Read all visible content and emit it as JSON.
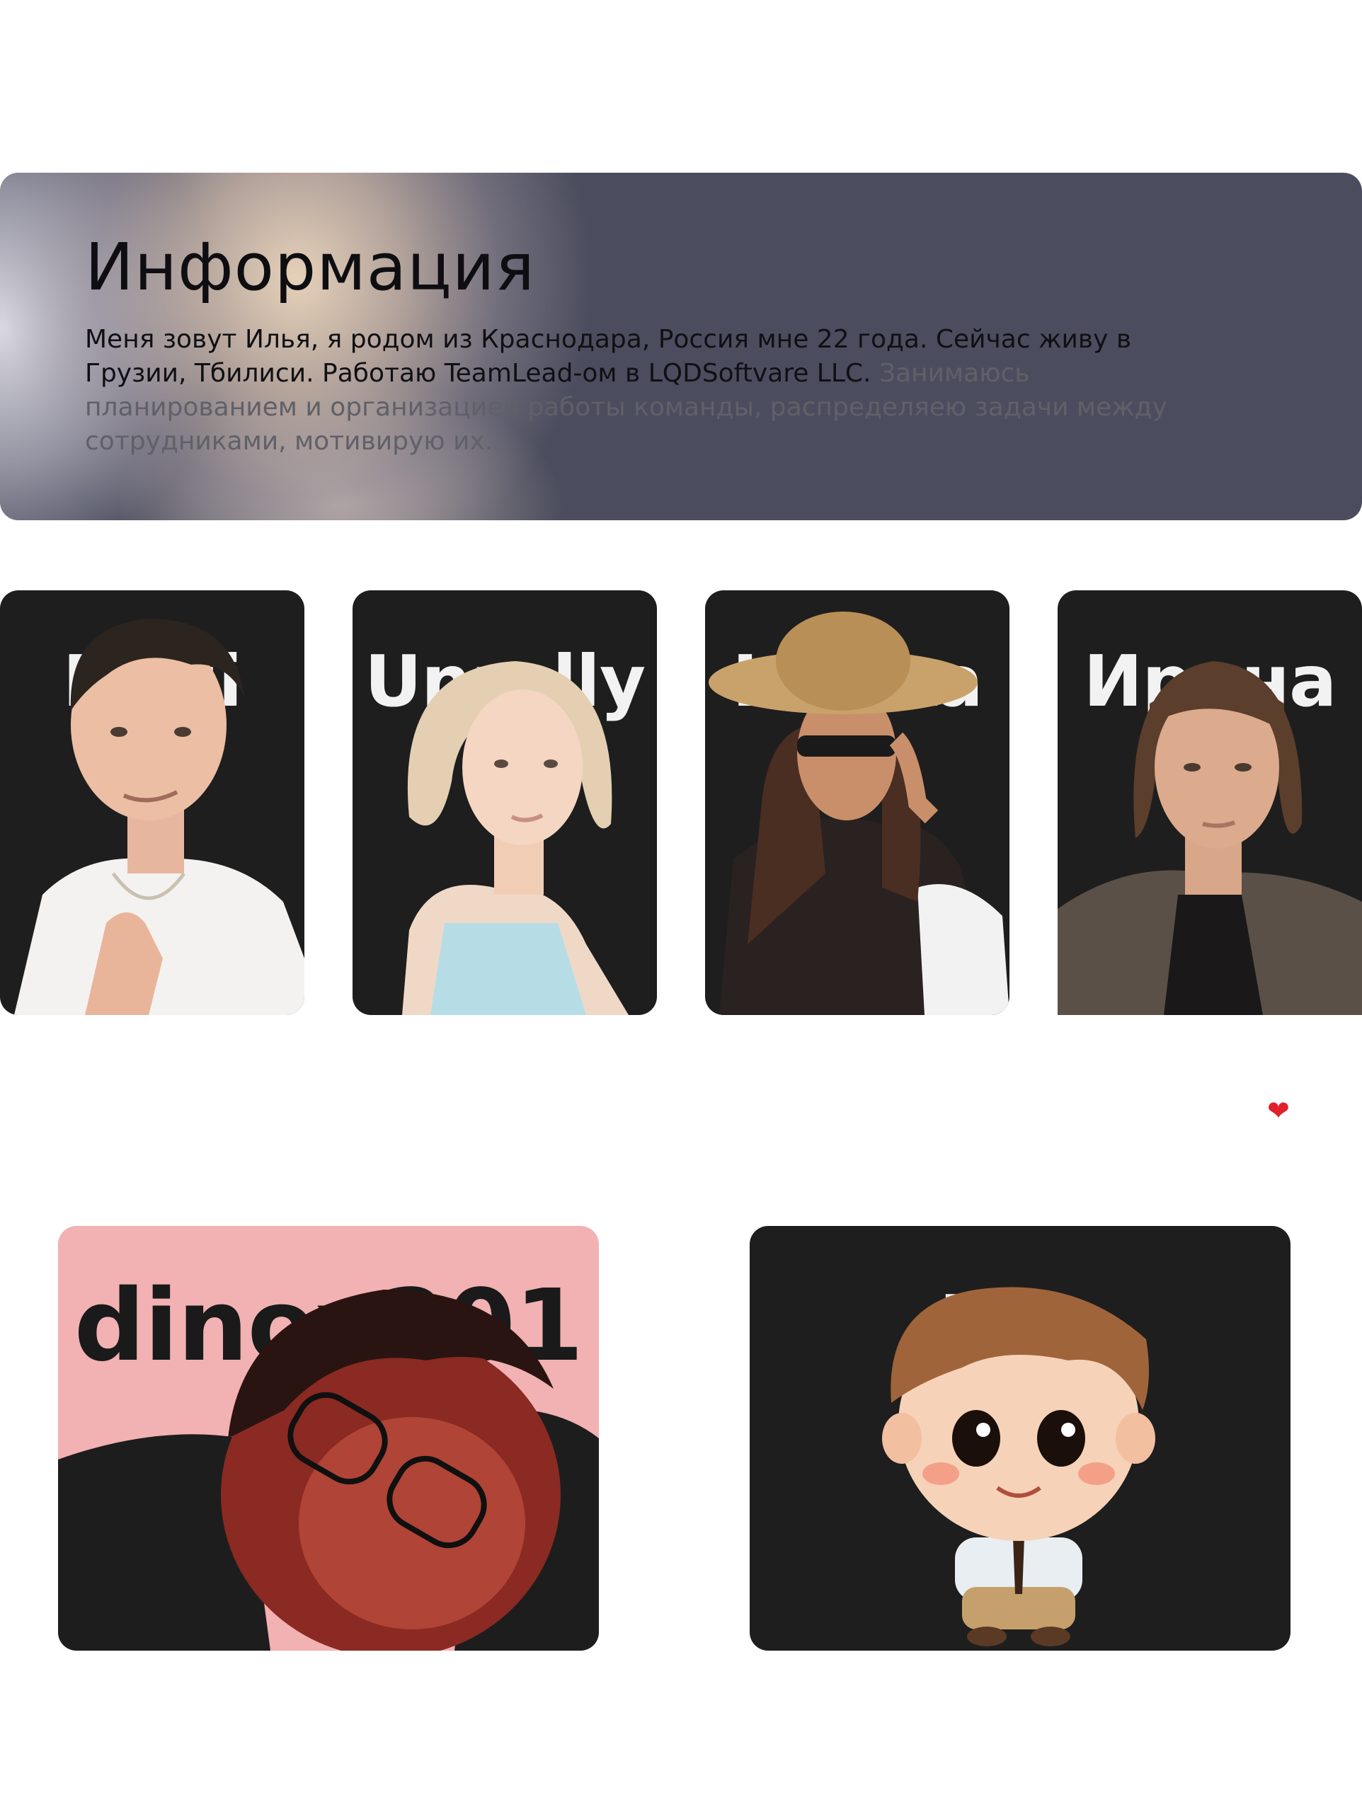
{
  "info": {
    "title": "Информация",
    "text_main": "Меня зовут Илья, я родом из Краснодара, Россия мне 22 года. Сейчас живу в Грузии, Тбилиси. Работаю TeamLead-ом в LQDSoftvare LLC. ",
    "text_muted": "Занимаюсь планированием и организацией работы команды, распределяею задачи между сотрудниками, мотивирую их."
  },
  "cards": [
    {
      "nick": "Nagi"
    },
    {
      "nick": "Unrelly"
    },
    {
      "nick": "Iriidka"
    },
    {
      "nick": "Ирина"
    }
  ],
  "big_cards": [
    {
      "nick": "dinox201"
    },
    {
      "nick": "Nix"
    }
  ],
  "heart": "❤"
}
